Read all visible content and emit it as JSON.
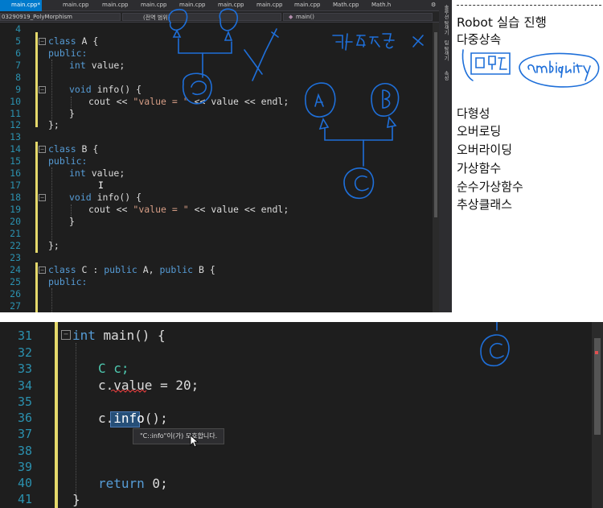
{
  "top_editor": {
    "tabs": [
      "main.cpp*",
      "main.cpp",
      "main.cpp",
      "main.cpp",
      "main.cpp",
      "main.cpp",
      "main.cpp",
      "main.cpp",
      "Math.cpp",
      "Math.h"
    ],
    "nav": {
      "project": "03290919_PolyMorphism",
      "scope": "(전역 범위)",
      "function": "main()"
    },
    "right_rail": [
      "솔루션 탐색기",
      "팀 탐색기",
      "속성"
    ],
    "line_numbers": [
      "4",
      "5",
      "6",
      "7",
      "8",
      "9",
      "10",
      "11",
      "12",
      "13",
      "14",
      "15",
      "16",
      "17",
      "18",
      "19",
      "20",
      "21",
      "22",
      "23",
      "24",
      "25",
      "26",
      "27"
    ],
    "code": {
      "l5_kw": "class",
      "l5_rest": " A {",
      "l6": "public:",
      "l7_kw": "int",
      "l7_rest": " value;",
      "l9_kw": "void",
      "l9_rest": " info() {",
      "l10_a": "cout << ",
      "l10_str": "\"value = \"",
      "l10_b": " << value << endl;",
      "l11": "}",
      "l12": "};",
      "l14_kw": "class",
      "l14_rest": " B {",
      "l15": "public:",
      "l16_kw": "int",
      "l16_rest": " value;",
      "l17": "I",
      "l18_kw": "void",
      "l18_rest": " info() {",
      "l19_a": "cout << ",
      "l19_str": "\"value = \"",
      "l19_b": " << value << endl;",
      "l20": "}",
      "l22": "};",
      "l24_kw": "class",
      "l24_c": " C : ",
      "l24_kw2": "public",
      "l24_a": " A, ",
      "l24_kw3": "public",
      "l24_b": " B {",
      "l25": "public:"
    }
  },
  "notes": {
    "title": "Robot 실습 진행",
    "line2": "다중상속",
    "topics": [
      "다형성",
      "오버로딩",
      "오버라이딩",
      "가상함수",
      "순수가상함수",
      "추상클래스"
    ]
  },
  "bottom_editor": {
    "line_numbers": [
      "31",
      "32",
      "33",
      "34",
      "35",
      "36",
      "37",
      "38",
      "39",
      "40",
      "41"
    ],
    "code": {
      "l31_kw": "int",
      "l31_rest": " main() {",
      "l33": "C c;",
      "l34_a": "c.",
      "l34_b": "value",
      "l34_c": " = 20;",
      "l36_a": "c.",
      "l36_b": "info",
      "l36_c": "();",
      "l40_kw": "return",
      "l40_rest": " 0;",
      "l41": "}"
    },
    "tooltip": "\"C::info\"이(가) 모호합니다."
  },
  "colors": {
    "editor_bg": "#1e1e1e",
    "keyword": "#569cd6",
    "string": "#d69d85",
    "line_number": "#2b91af",
    "ink": "#1e6fd9",
    "change_bar": "#e5d96b"
  },
  "annotations": {
    "korean_scribble": "다중상속",
    "box_note": "모호함",
    "ambiguity": "ambiguity",
    "node_a": "A",
    "node_b": "B",
    "node_c": "C"
  }
}
